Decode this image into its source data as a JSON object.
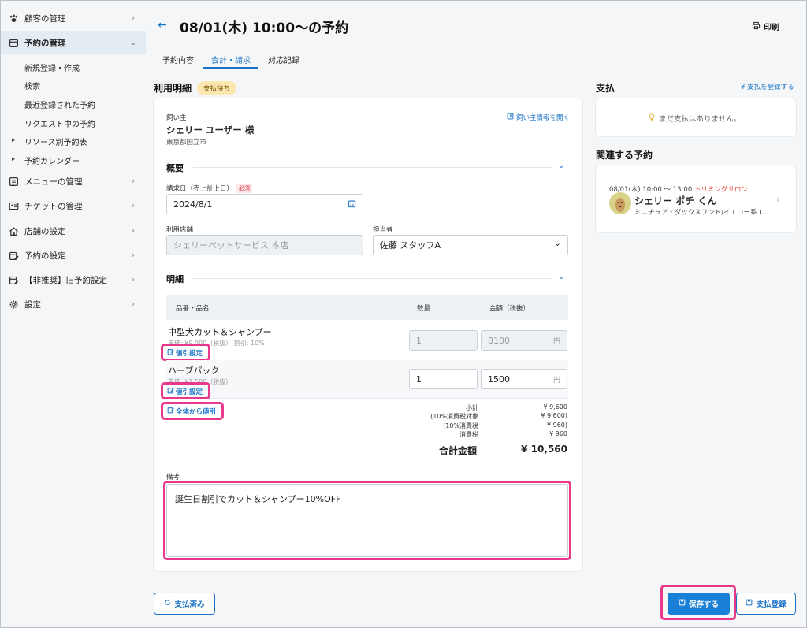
{
  "sidebar": {
    "items": [
      {
        "label": "顧客の管理",
        "icon": "paw-icon"
      },
      {
        "label": "予約の管理",
        "icon": "calendar-icon"
      },
      {
        "label": "メニューの管理",
        "icon": "list-icon"
      },
      {
        "label": "チケットの管理",
        "icon": "ticket-icon"
      },
      {
        "label": "店舗の設定",
        "icon": "home-icon"
      },
      {
        "label": "予約の設定",
        "icon": "edit-calendar-icon"
      },
      {
        "label": "【非推奨】旧予約設定",
        "icon": "edit-calendar-icon"
      },
      {
        "label": "設定",
        "icon": "gear-icon"
      }
    ],
    "sub_items": [
      "新規登録・作成",
      "検索",
      "最近登録された予約",
      "リクエスト中の予約",
      "リソース別予約表",
      "予約カレンダー"
    ]
  },
  "header": {
    "title": "08/01(木) 10:00〜の予約",
    "print_label": "印刷",
    "tabs": [
      "予約内容",
      "会計・請求",
      "対応記録"
    ]
  },
  "usage": {
    "title": "利用明細",
    "status_badge": "支払待ち",
    "owner_label": "飼い主",
    "owner_name": "シェリー ユーザー 様",
    "owner_address": "東京都国立市",
    "open_owner_link": "飼い主情報を開く",
    "summary_label": "概要",
    "bill_date_label": "請求日（売上計上日）",
    "required_label": "必須",
    "bill_date_value": "2024/8/1",
    "store_label": "利用店舗",
    "store_value": "シェリーペットサービス 本店",
    "staff_label": "担当者",
    "staff_value": "佐藤 スタッフA",
    "detail_label": "明細",
    "col_item": "品番・品名",
    "col_qty": "数量",
    "col_amount": "金額（税抜）",
    "rows": [
      {
        "name": "中型犬カット＆シャンプー",
        "sub": "単価: ¥9,000（税抜） 割引: 10%",
        "qty": "1",
        "amount": "8100",
        "unit": "円",
        "discount": "値引設定"
      },
      {
        "name": "ハーブパック",
        "sub": "単価: ¥1,500（税抜）",
        "qty": "1",
        "amount": "1500",
        "unit": "円",
        "discount": "値引設定"
      }
    ],
    "whole_discount": "全体から値引",
    "summary_lines": [
      {
        "label": "小計",
        "value": "¥ 9,600"
      },
      {
        "label": "(10%消費税対象",
        "value": "¥ 9,600)"
      },
      {
        "label": "(10%消費税",
        "value": "¥ 960)"
      },
      {
        "label": "消費税",
        "value": "¥ 960"
      }
    ],
    "total_label": "合計金額",
    "total_value": "¥ 10,560",
    "note_label": "備考",
    "note_value": "誕生日割引でカット＆シャンプー10%OFF"
  },
  "payment": {
    "title": "支払",
    "register_link": "¥ 支払を登録する",
    "empty_text": "まだ支払はありません。"
  },
  "related": {
    "title": "関連する予約",
    "date": "08/01(木) 10:00 〜 13:00",
    "salon": "トリミングサロン",
    "pet_name": "シェリー ポチ くん",
    "breed": "ミニチュア・ダックスフンド/イエロー系 (…"
  },
  "footer": {
    "paid_label": "支払済み",
    "save_label": "保存する",
    "register_pay_label": "支払登録"
  },
  "colors": {
    "accent": "#1a73c8",
    "highlight": "#e8388b",
    "badge": "#fbe7b0"
  }
}
